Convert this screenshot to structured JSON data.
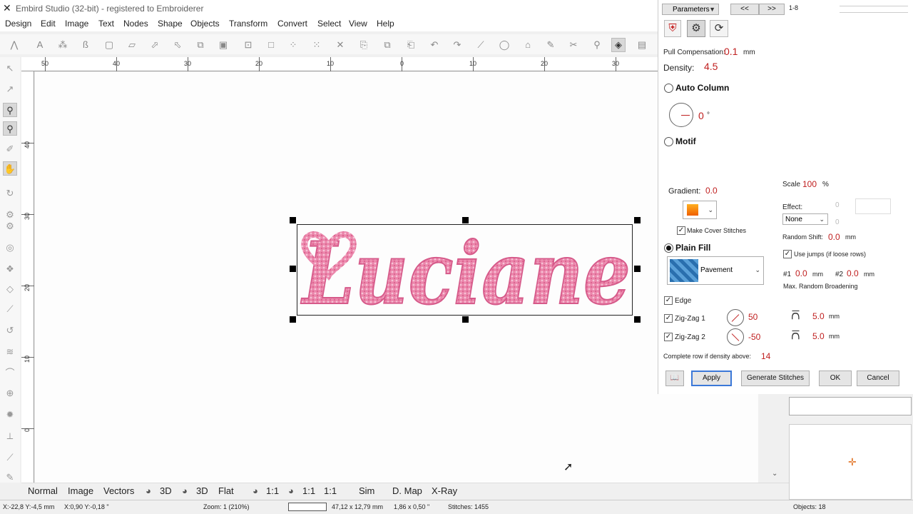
{
  "window": {
    "title": "Embird Studio (32-bit) - registered to Embroiderer"
  },
  "menu": [
    "Design",
    "Edit",
    "Image",
    "Text",
    "Nodes",
    "Shape",
    "Objects",
    "Transform",
    "Convert",
    "Select",
    "View",
    "Help"
  ],
  "ruler": {
    "h_labels": [
      "50",
      "40",
      "30",
      "20",
      "10",
      "0",
      "10",
      "20",
      "30"
    ],
    "v_labels": [
      "40",
      "30",
      "20",
      "10",
      "0"
    ]
  },
  "bottom_tabs": [
    "Normal",
    "Image",
    "Vectors",
    "3D",
    "3D",
    "Flat",
    "1:1",
    "1:1",
    "1:1",
    "Sim",
    "D. Map",
    "X-Ray"
  ],
  "status": {
    "pos1": "X:-22,8  Y:-4,5 mm",
    "pos2": "X:0,90  Y:-0,18 \"",
    "zoom": "Zoom: 1 (210%)",
    "size_mm": "47,12 x 12,79 mm",
    "size_in": "1,86 x 0,50 \"",
    "stitches": "Stitches: 1455",
    "objects": "Objects: 18"
  },
  "design_text": "Luciane",
  "panel": {
    "parameters_label": "Parameters",
    "prev_label": "<<",
    "next_label": ">>",
    "range_label": "1-8",
    "pull_comp_label": "Pull Compensation:",
    "pull_comp_value": "0.1",
    "pull_comp_unit": "mm",
    "density_label": "Density:",
    "density_value": "4.5",
    "auto_column_label": "Auto Column",
    "angle_value": "0",
    "angle_unit": "°",
    "motif_label": "Motif",
    "gradient_label": "Gradient:",
    "gradient_value": "0.0",
    "scale_label": "Scale",
    "scale_value": "100",
    "scale_unit": "%",
    "effect_label": "Effect:",
    "effect_value": "None",
    "effect_num1": "0",
    "effect_num2": "0",
    "make_cover_label": "Make Cover Stitches",
    "random_shift_label": "Random Shift:",
    "random_shift_value": "0.0",
    "random_shift_unit": "mm",
    "plain_fill_label": "Plain Fill",
    "pattern_value": "Pavement",
    "use_jumps_label": "Use jumps (if loose rows)",
    "b1_label": "#1",
    "b1_value": "0.0",
    "b1_unit": "mm",
    "b2_label": "#2",
    "b2_value": "0.0",
    "b2_unit": "mm",
    "max_random_label": "Max. Random Broadening",
    "edge_label": "Edge",
    "zz1_label": "Zig-Zag 1",
    "zz1_value": "50",
    "zz1_len": "5.0",
    "zz1_unit": "mm",
    "zz2_label": "Zig-Zag 2",
    "zz2_value": "-50",
    "zz2_len": "5.0",
    "zz2_unit": "mm",
    "complete_row_label": "Complete row if density above:",
    "complete_row_value": "14",
    "apply_label": "Apply",
    "generate_label": "Generate Stitches",
    "ok_label": "OK",
    "cancel_label": "Cancel"
  },
  "colors": {
    "accent_red": "#c02020",
    "embroidery_pink": "#e8789f",
    "gradient_orange": "#f07c10"
  }
}
